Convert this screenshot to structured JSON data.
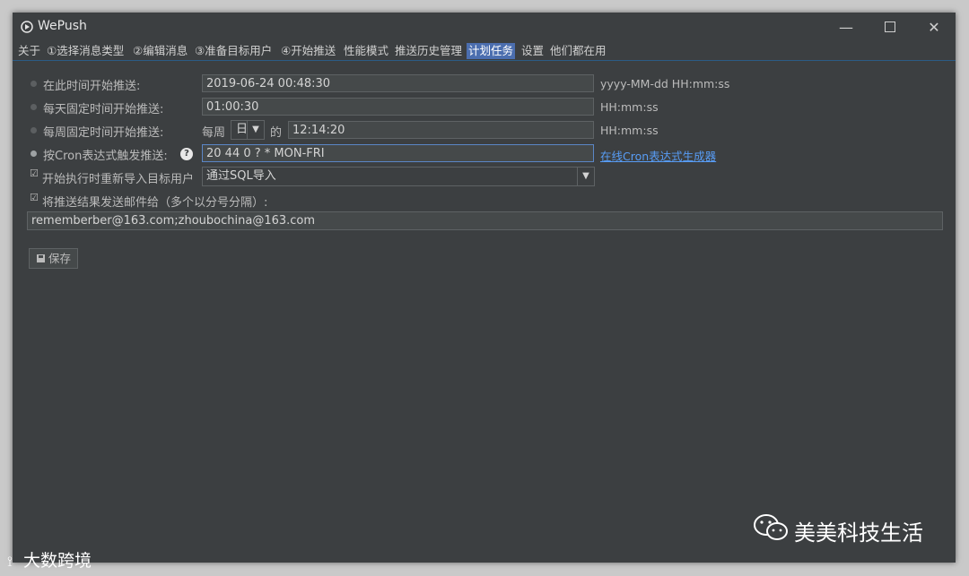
{
  "window": {
    "title": "WePush"
  },
  "tabs": [
    {
      "label": "关于",
      "active": false
    },
    {
      "label": "①选择消息类型",
      "active": false
    },
    {
      "label": "②编辑消息",
      "active": false
    },
    {
      "label": "③准备目标用户",
      "active": false
    },
    {
      "label": "④开始推送",
      "active": false
    },
    {
      "label": "性能模式",
      "active": false
    },
    {
      "label": "推送历史管理",
      "active": false
    },
    {
      "label": "计划任务",
      "active": true
    },
    {
      "label": "设置",
      "active": false
    },
    {
      "label": "他们都在用",
      "active": false
    }
  ],
  "schedule": {
    "at_time": {
      "label": "在此时间开始推送:",
      "value": "2019-06-24 00:48:30",
      "format": "yyyy-MM-dd HH:mm:ss",
      "selected": false
    },
    "daily": {
      "label": "每天固定时间开始推送:",
      "value": "01:00:30",
      "format": "HH:mm:ss",
      "selected": false
    },
    "weekly": {
      "label": "每周固定时间开始推送:",
      "prefix": "每周",
      "day": "日",
      "between": "的",
      "value": "12:14:20",
      "format": "HH:mm:ss",
      "selected": false
    },
    "cron": {
      "label": "按Cron表达式触发推送:",
      "help": "?",
      "value": "20 44 0 ? * MON-FRI",
      "link": "在线Cron表达式生成器",
      "selected": true
    }
  },
  "reimport": {
    "checked": true,
    "label": "开始执行时重新导入目标用户",
    "option": "通过SQL导入"
  },
  "email": {
    "checked": true,
    "label": "将推送结果发送邮件给（多个以分号分隔）:",
    "value": "rememberber@163.com;zhoubochina@163.com"
  },
  "save_button": {
    "label": "保存"
  },
  "watermarks": {
    "wechat": "美美科技生活",
    "bottom": "大数跨境"
  },
  "colors": {
    "background": "#3c3f41",
    "field": "#45494a",
    "accent": "#4b6eaf",
    "link": "#589df6"
  }
}
